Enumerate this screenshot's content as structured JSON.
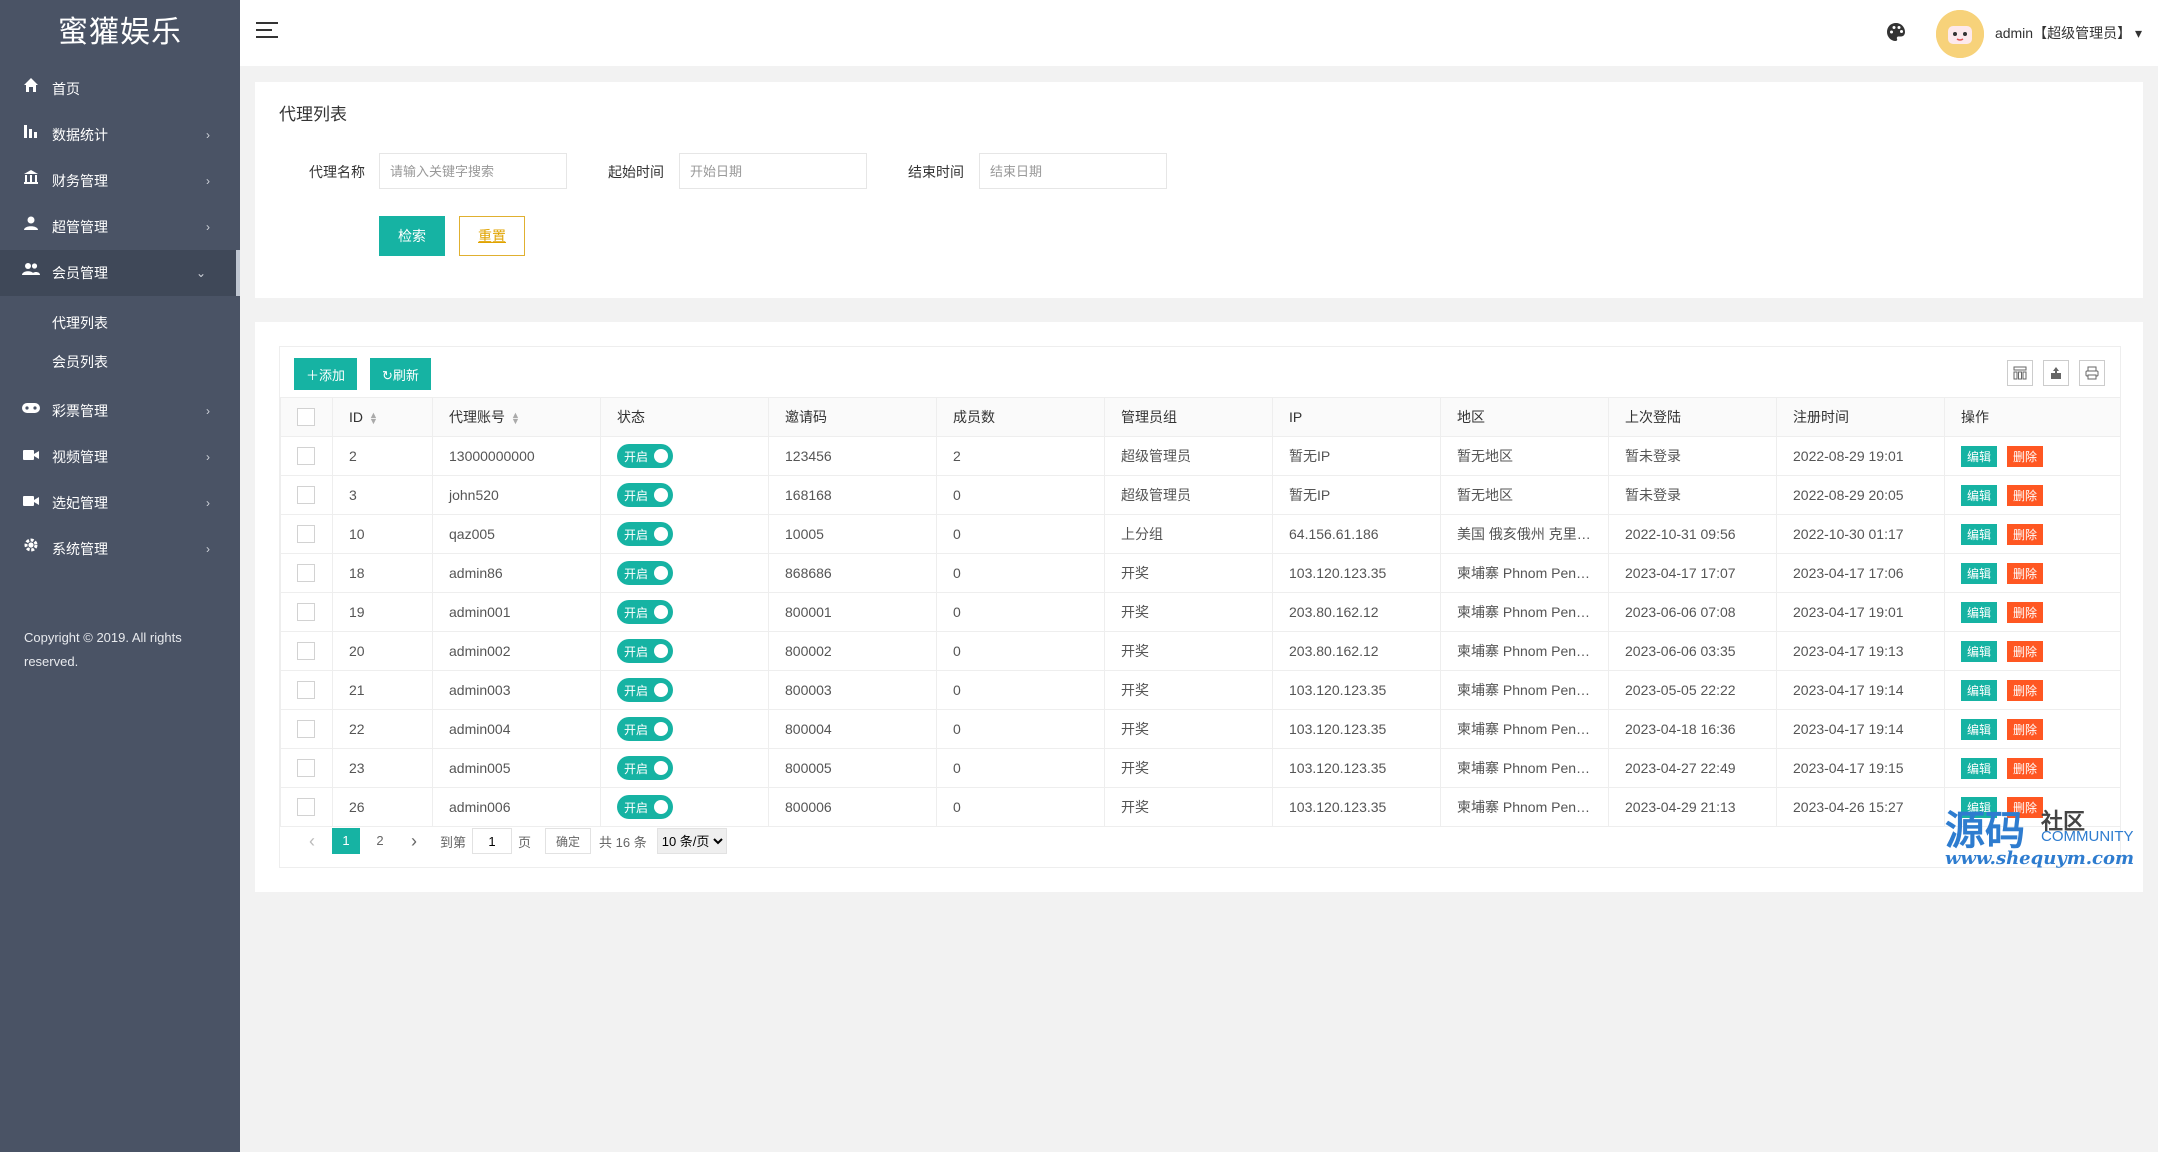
{
  "sidebar": {
    "logo": "蜜獾娱乐",
    "items": [
      {
        "label": "首页",
        "icon": "home-icon",
        "arrow": ""
      },
      {
        "label": "数据统计",
        "icon": "bar-chart-icon",
        "arrow": "›"
      },
      {
        "label": "财务管理",
        "icon": "bank-icon",
        "arrow": "›"
      },
      {
        "label": "超管管理",
        "icon": "user-icon",
        "arrow": "›"
      },
      {
        "label": "会员管理",
        "icon": "users-icon",
        "arrow": "⌄"
      }
    ],
    "subitems": [
      {
        "label": "代理列表"
      },
      {
        "label": "会员列表"
      }
    ],
    "items2": [
      {
        "label": "彩票管理",
        "icon": "gamepad-icon",
        "arrow": "›"
      },
      {
        "label": "视频管理",
        "icon": "video-icon",
        "arrow": "›"
      },
      {
        "label": "选妃管理",
        "icon": "video2-icon",
        "arrow": "›"
      },
      {
        "label": "系统管理",
        "icon": "gear-icon",
        "arrow": "›"
      }
    ],
    "copyright": "Copyright © 2019. All rights reserved."
  },
  "header": {
    "user": "admin【超级管理员】",
    "user_arrow": "▾"
  },
  "search": {
    "title": "代理列表",
    "name_label": "代理名称",
    "name_placeholder": "请输入关键字搜索",
    "start_label": "起始时间",
    "start_placeholder": "开始日期",
    "end_label": "结束时间",
    "end_placeholder": "结束日期",
    "search_btn": "检索",
    "reset_btn": "重置"
  },
  "toolbar": {
    "add_label": "添加",
    "refresh_label": "刷新"
  },
  "table": {
    "headers": [
      "ID",
      "代理账号",
      "状态",
      "邀请码",
      "成员数",
      "管理员组",
      "IP",
      "地区",
      "上次登陆",
      "注册时间",
      "操作"
    ],
    "switch_label": "开启",
    "edit_label": "编辑",
    "delete_label": "删除",
    "rows": [
      {
        "id": "2",
        "account": "13000000000",
        "code": "123456",
        "members": "2",
        "group": "超级管理员",
        "ip": "暂无IP",
        "region": "暂无地区",
        "last_login": "暂未登录",
        "reg_time": "2022-08-29 19:01"
      },
      {
        "id": "3",
        "account": "john520",
        "code": "168168",
        "members": "0",
        "group": "超级管理员",
        "ip": "暂无IP",
        "region": "暂无地区",
        "last_login": "暂未登录",
        "reg_time": "2022-08-29 20:05"
      },
      {
        "id": "10",
        "account": "qaz005",
        "code": "10005",
        "members": "0",
        "group": "上分组",
        "ip": "64.156.61.186",
        "region": "美国 俄亥俄州 克里…",
        "last_login": "2022-10-31 09:56",
        "reg_time": "2022-10-30 01:17"
      },
      {
        "id": "18",
        "account": "admin86",
        "code": "868686",
        "members": "0",
        "group": "开奖",
        "ip": "103.120.123.35",
        "region": "柬埔寨 Phnom Pen…",
        "last_login": "2023-04-17 17:07",
        "reg_time": "2023-04-17 17:06"
      },
      {
        "id": "19",
        "account": "admin001",
        "code": "800001",
        "members": "0",
        "group": "开奖",
        "ip": "203.80.162.12",
        "region": "柬埔寨 Phnom Pen…",
        "last_login": "2023-06-06 07:08",
        "reg_time": "2023-04-17 19:01"
      },
      {
        "id": "20",
        "account": "admin002",
        "code": "800002",
        "members": "0",
        "group": "开奖",
        "ip": "203.80.162.12",
        "region": "柬埔寨 Phnom Pen…",
        "last_login": "2023-06-06 03:35",
        "reg_time": "2023-04-17 19:13"
      },
      {
        "id": "21",
        "account": "admin003",
        "code": "800003",
        "members": "0",
        "group": "开奖",
        "ip": "103.120.123.35",
        "region": "柬埔寨 Phnom Pen…",
        "last_login": "2023-05-05 22:22",
        "reg_time": "2023-04-17 19:14"
      },
      {
        "id": "22",
        "account": "admin004",
        "code": "800004",
        "members": "0",
        "group": "开奖",
        "ip": "103.120.123.35",
        "region": "柬埔寨 Phnom Pen…",
        "last_login": "2023-04-18 16:36",
        "reg_time": "2023-04-17 19:14"
      },
      {
        "id": "23",
        "account": "admin005",
        "code": "800005",
        "members": "0",
        "group": "开奖",
        "ip": "103.120.123.35",
        "region": "柬埔寨 Phnom Pen…",
        "last_login": "2023-04-27 22:49",
        "reg_time": "2023-04-17 19:15"
      },
      {
        "id": "26",
        "account": "admin006",
        "code": "800006",
        "members": "0",
        "group": "开奖",
        "ip": "103.120.123.35",
        "region": "柬埔寨 Phnom Pen…",
        "last_login": "2023-04-29 21:13",
        "reg_time": "2023-04-26 15:27"
      }
    ]
  },
  "pager": {
    "prev": "‹",
    "pages": [
      "1",
      "2"
    ],
    "next": "›",
    "goto_label": "到第",
    "goto_value": "1",
    "page_unit": "页",
    "confirm": "确定",
    "total": "共 16 条",
    "per_page": "10 条/页"
  },
  "watermark": {
    "main": "源码",
    "sub": "社区",
    "en": "COMMUNITY",
    "url": "www.shequym.com"
  },
  "colors": {
    "sidebar_bg": "#4a5365",
    "accent": "#16b3a3",
    "danger": "#ff5722",
    "warning": "#e0a300"
  }
}
